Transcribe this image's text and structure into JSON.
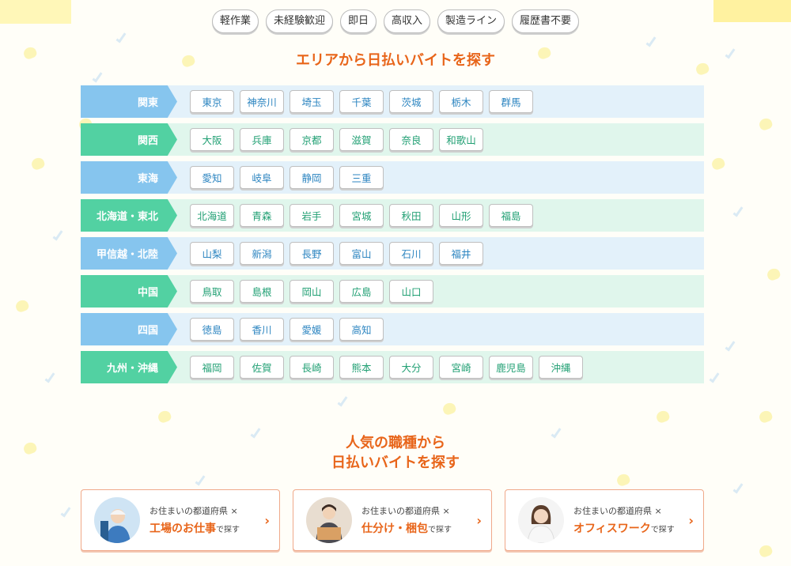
{
  "tags": [
    "軽作業",
    "未経験歓迎",
    "即日",
    "高収入",
    "製造ライン",
    "履歴書不要"
  ],
  "area_section": {
    "title": "エリアから日払いバイトを探す"
  },
  "regions": [
    {
      "label": "関東",
      "prefectures": [
        "東京",
        "神奈川",
        "埼玉",
        "千葉",
        "茨城",
        "栃木",
        "群馬"
      ]
    },
    {
      "label": "関西",
      "prefectures": [
        "大阪",
        "兵庫",
        "京都",
        "滋賀",
        "奈良",
        "和歌山"
      ]
    },
    {
      "label": "東海",
      "prefectures": [
        "愛知",
        "岐阜",
        "静岡",
        "三重"
      ]
    },
    {
      "label": "北海道・東北",
      "prefectures": [
        "北海道",
        "青森",
        "岩手",
        "宮城",
        "秋田",
        "山形",
        "福島"
      ]
    },
    {
      "label": "甲信越・北陸",
      "prefectures": [
        "山梨",
        "新潟",
        "長野",
        "富山",
        "石川",
        "福井"
      ]
    },
    {
      "label": "中国",
      "prefectures": [
        "鳥取",
        "島根",
        "岡山",
        "広島",
        "山口"
      ]
    },
    {
      "label": "四国",
      "prefectures": [
        "徳島",
        "香川",
        "愛媛",
        "高知"
      ]
    },
    {
      "label": "九州・沖縄",
      "prefectures": [
        "福岡",
        "佐賀",
        "長崎",
        "熊本",
        "大分",
        "宮崎",
        "鹿児島",
        "沖縄"
      ]
    }
  ],
  "job_section": {
    "title_line1": "人気の職種から",
    "title_line2": "日払いバイトを探す"
  },
  "job_cards": [
    {
      "sub": "お住まいの都道府県 ×",
      "main": "工場のお仕事",
      "suffix": "で探す",
      "photo": "factory-worker-photo"
    },
    {
      "sub": "お住まいの都道府県 ×",
      "main": "仕分け・梱包",
      "suffix": "で探す",
      "photo": "packing-worker-photo"
    },
    {
      "sub": "お住まいの都道府県 ×",
      "main": "オフィスワーク",
      "suffix": "で探す",
      "photo": "office-worker-photo"
    }
  ],
  "colors": {
    "accent": "#e8651a",
    "region_blue": "#86c5ee",
    "region_green": "#52d1a2"
  }
}
